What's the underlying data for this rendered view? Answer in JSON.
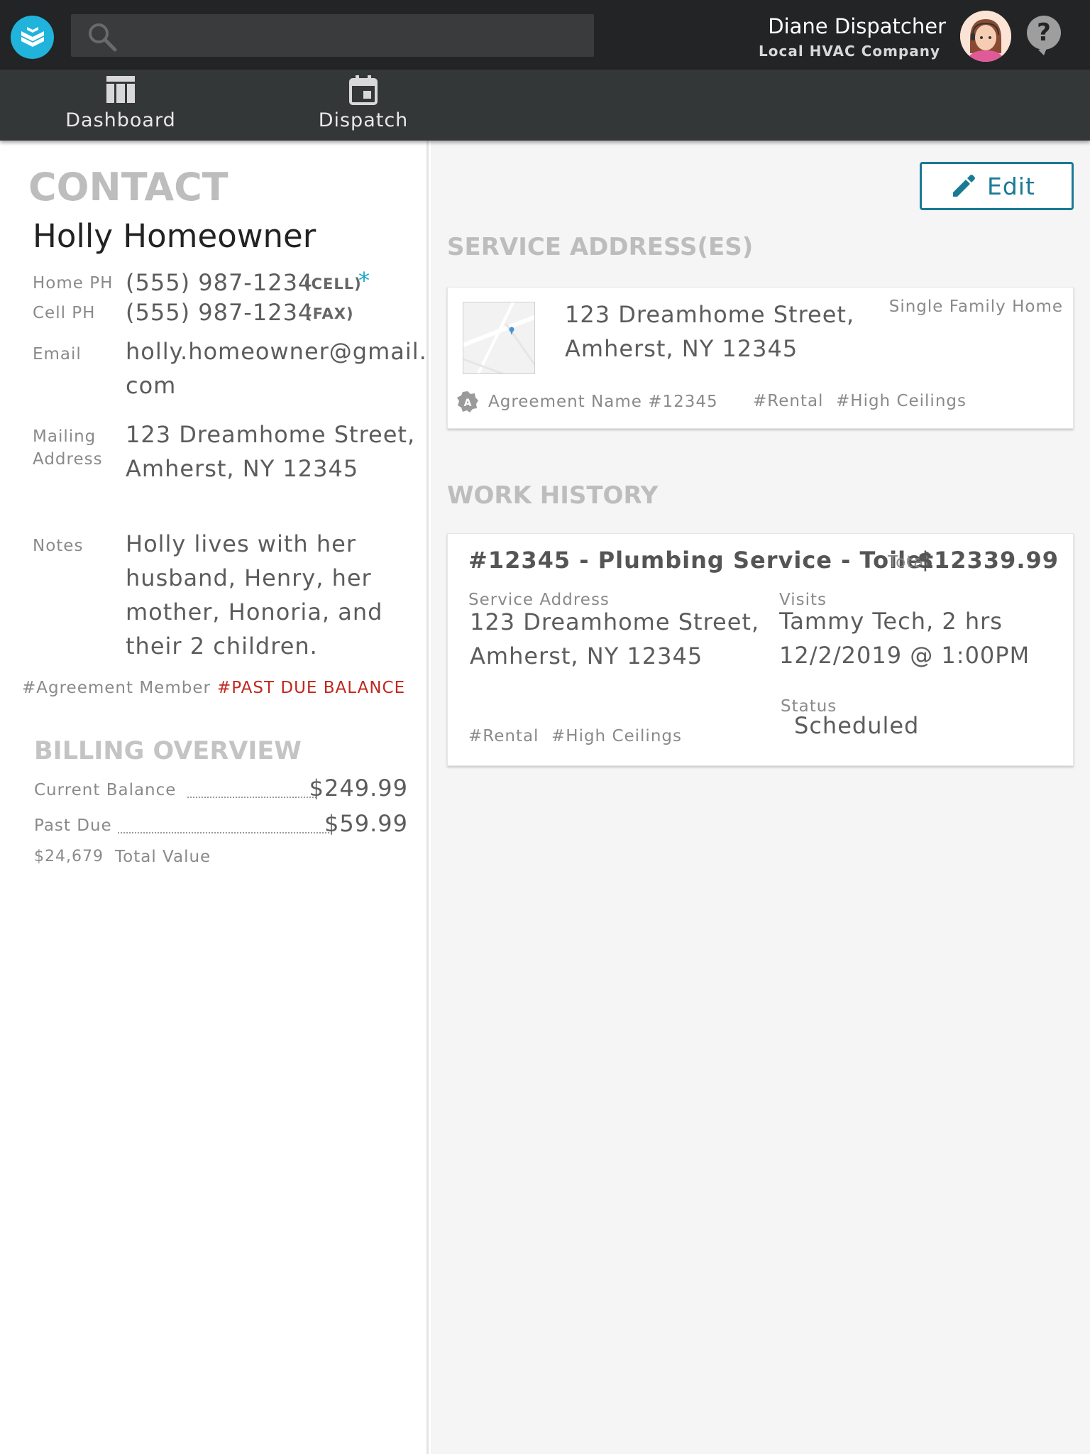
{
  "header": {
    "search_placeholder": "",
    "user_name": "Diane Dispatcher",
    "user_company": "Local HVAC Company",
    "accent": "#20b4dc"
  },
  "nav": {
    "dashboard_label": "Dashboard",
    "dispatch_label": "Dispatch"
  },
  "contact": {
    "section_title": "CONTACT",
    "name": "Holly Homeowner",
    "home_ph_label": "Home PH",
    "home_ph_value": "(555) 987-1234",
    "home_ph_type": "(CELL)",
    "primary_marker": "*",
    "cell_ph_label": "Cell PH",
    "cell_ph_value": "(555) 987-1234",
    "cell_ph_type": "(FAX)",
    "email_label": "Email",
    "email_line1": "holly.homeowner@gmail.",
    "email_line2": "com",
    "mailing_label_line1": "Mailing",
    "mailing_label_line2": "Address",
    "mailing_line1": "123 Dreamhome Street,",
    "mailing_line2": "Amherst, NY 12345",
    "notes_label": "Notes",
    "notes_lines": [
      "Holly lives with her",
      "husband, Henry, her",
      "mother, Honoria, and",
      "their 2 children."
    ],
    "tag_member": "#Agreement Member",
    "tag_past_due": "#PAST DUE BALANCE",
    "status_red": "#c0281e"
  },
  "billing": {
    "title": "BILLING OVERVIEW",
    "current_balance_label": "Current Balance",
    "current_balance_value": "$249.99",
    "past_due_label": "Past Due",
    "past_due_value": "$59.99",
    "total_value_amount": "$24,679",
    "total_value_label": "Total Value"
  },
  "service": {
    "edit_label": "Edit",
    "section_title": "SERVICE ADDRESS(ES)",
    "address_line1": "123 Dreamhome Street,",
    "address_line2": "Amherst, NY 12345",
    "property_type": "Single Family Home",
    "agreement_name": "Agreement Name #12345",
    "tags": [
      "#Rental",
      "#High Ceilings"
    ]
  },
  "work_history": {
    "section_title": "WORK HISTORY",
    "job_title": "#12345 - Plumbing Service - Toilet",
    "total_label": "Total",
    "total_value": "$12339.99",
    "service_address_label": "Service Address",
    "address_line1": "123 Dreamhome Street,",
    "address_line2": "Amherst, NY 12345",
    "visits_label": "Visits",
    "visit_line1": "Tammy Tech, 2 hrs",
    "visit_line2": "12/2/2019 @ 1:00PM",
    "status_label": "Status",
    "status_value": "Scheduled",
    "tags": [
      "#Rental",
      "#High Ceilings"
    ]
  }
}
